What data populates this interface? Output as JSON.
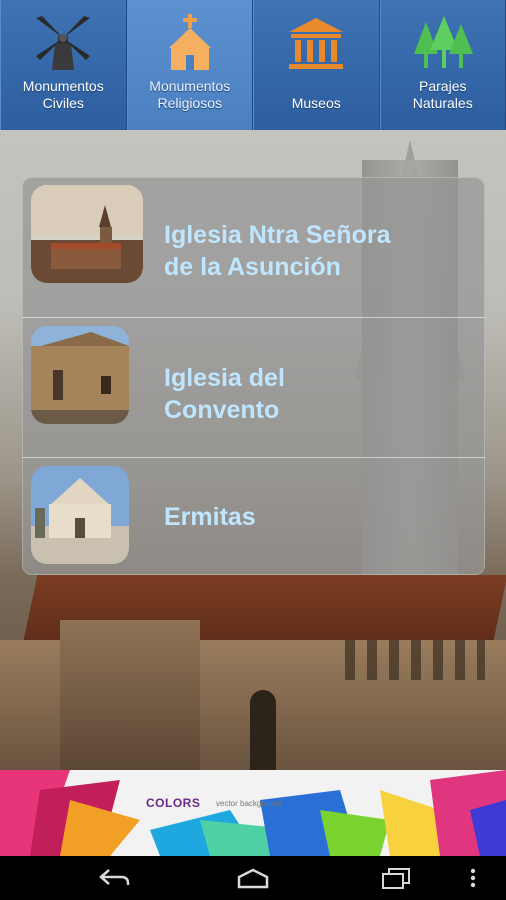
{
  "tabs": [
    {
      "line1": "Monumentos",
      "line2": "Civiles",
      "icon": "windmill-icon",
      "active": false
    },
    {
      "line1": "Monumentos",
      "line2": "Religiosos",
      "icon": "church-icon",
      "active": true
    },
    {
      "line1": "Museos",
      "line2": "",
      "icon": "museum-icon",
      "active": false
    },
    {
      "line1": "Parajes",
      "line2": "Naturales",
      "icon": "trees-icon",
      "active": false
    }
  ],
  "items": [
    {
      "line1": "Iglesia Ntra Señora",
      "line2": "de la Asunción"
    },
    {
      "line1": "Iglesia del",
      "line2": "Convento"
    },
    {
      "line1": "Ermitas",
      "line2": ""
    }
  ],
  "banner": {
    "title": "COLORS",
    "subtitle": "vector background"
  },
  "colors": {
    "tabbar": "#3e73b4",
    "tab_active": "#5c92cf",
    "item_text": "#bfe6ff",
    "tree_green": "#4fbf52",
    "building_orange": "#e8892c"
  },
  "navbar": {
    "back": "back-icon",
    "home": "home-icon",
    "recents": "recents-icon",
    "menu": "overflow-icon"
  }
}
